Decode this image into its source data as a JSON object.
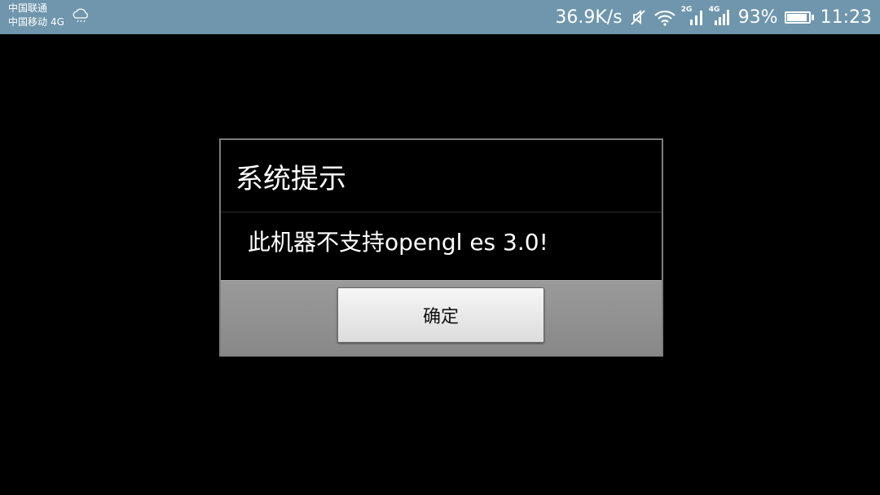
{
  "status_bar": {
    "carrier1": "中国联通",
    "carrier2": "中国移动",
    "carrier2_network": "4G",
    "net_speed": "36.9K/s",
    "signal1_tag": "2G",
    "signal2_tag": "4G",
    "battery_percent": "93%",
    "battery_level": 0.93,
    "time": "11:23",
    "icons": [
      "cloud-rain-icon",
      "mute-icon",
      "wifi-icon",
      "signal-icon",
      "signal-icon",
      "battery-icon"
    ]
  },
  "dialog": {
    "title": "系统提示",
    "message": "此机器不支持opengl es 3.0!",
    "ok_label": "确定"
  },
  "colors": {
    "status_bar_bg": "#6f96ad",
    "background": "#000000",
    "dialog_footer": "#8f8f8f",
    "button": "#e8e8e8"
  }
}
